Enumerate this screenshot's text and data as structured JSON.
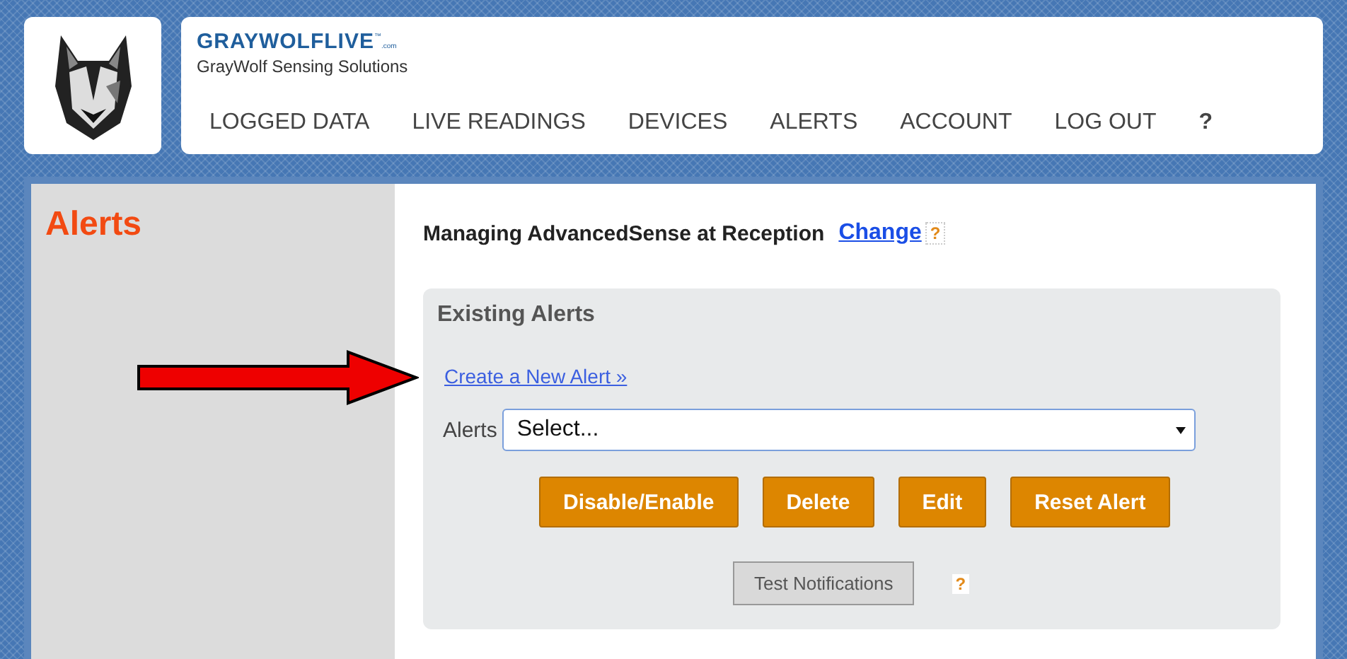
{
  "brand": {
    "name": "GRAYWOLFLIVE",
    "trademark": "™",
    "suffix": ".com",
    "tagline": "GrayWolf Sensing Solutions"
  },
  "nav": [
    {
      "label": "LOGGED DATA",
      "kind": "link"
    },
    {
      "label": "LIVE READINGS",
      "kind": "link"
    },
    {
      "label": "DEVICES",
      "kind": "link"
    },
    {
      "label": "ALERTS",
      "kind": "link"
    },
    {
      "label": "ACCOUNT",
      "kind": "link"
    },
    {
      "label": "LOG OUT",
      "kind": "link"
    },
    {
      "label": "?",
      "kind": "help"
    }
  ],
  "page_title": "Alerts",
  "managing": {
    "text": "Managing AdvancedSense at Reception",
    "link": "Change",
    "help": "?"
  },
  "existing_alerts": {
    "title": "Existing Alerts",
    "create_link": "Create a New Alert »",
    "select_label": "Alerts",
    "select_value": "Select...",
    "buttons": [
      "Disable/Enable",
      "Delete",
      "Edit",
      "Reset Alert"
    ],
    "test_button": "Test Notifications",
    "help": "?"
  }
}
